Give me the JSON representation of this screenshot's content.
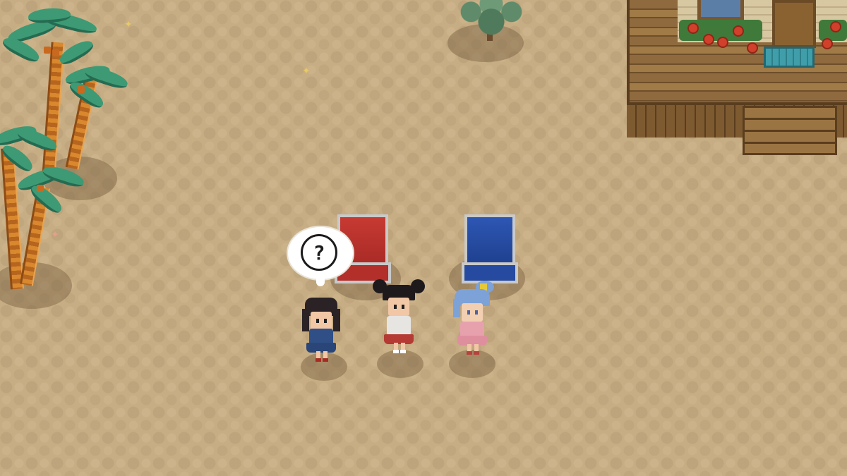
{
  "scene": {
    "location": "beach",
    "background_color": "#c7ad84"
  },
  "speech_bubble": {
    "icon": "question-mark-icon",
    "text": "?"
  },
  "characters": [
    {
      "id": "npc-dark-hair",
      "hair_color": "#2a2225",
      "outfit_color": "#2f4f86"
    },
    {
      "id": "npc-pigtails",
      "hair_color": "#1e1a1c",
      "outfit_color": "#b43a33"
    },
    {
      "id": "npc-blue-hair",
      "hair_color": "#7da2d8",
      "outfit_color": "#e7a1ad"
    }
  ],
  "objects": [
    {
      "id": "lounge-chair-red",
      "color": "#b32f29"
    },
    {
      "id": "lounge-chair-blue",
      "color": "#254a9f"
    },
    {
      "id": "palm-trees",
      "color": "#3d9a74"
    },
    {
      "id": "bush",
      "color": "#4f7a5b"
    },
    {
      "id": "beach-house",
      "color": "#8f6a3e"
    },
    {
      "id": "doormat",
      "color": "#3f9eaa"
    }
  ]
}
